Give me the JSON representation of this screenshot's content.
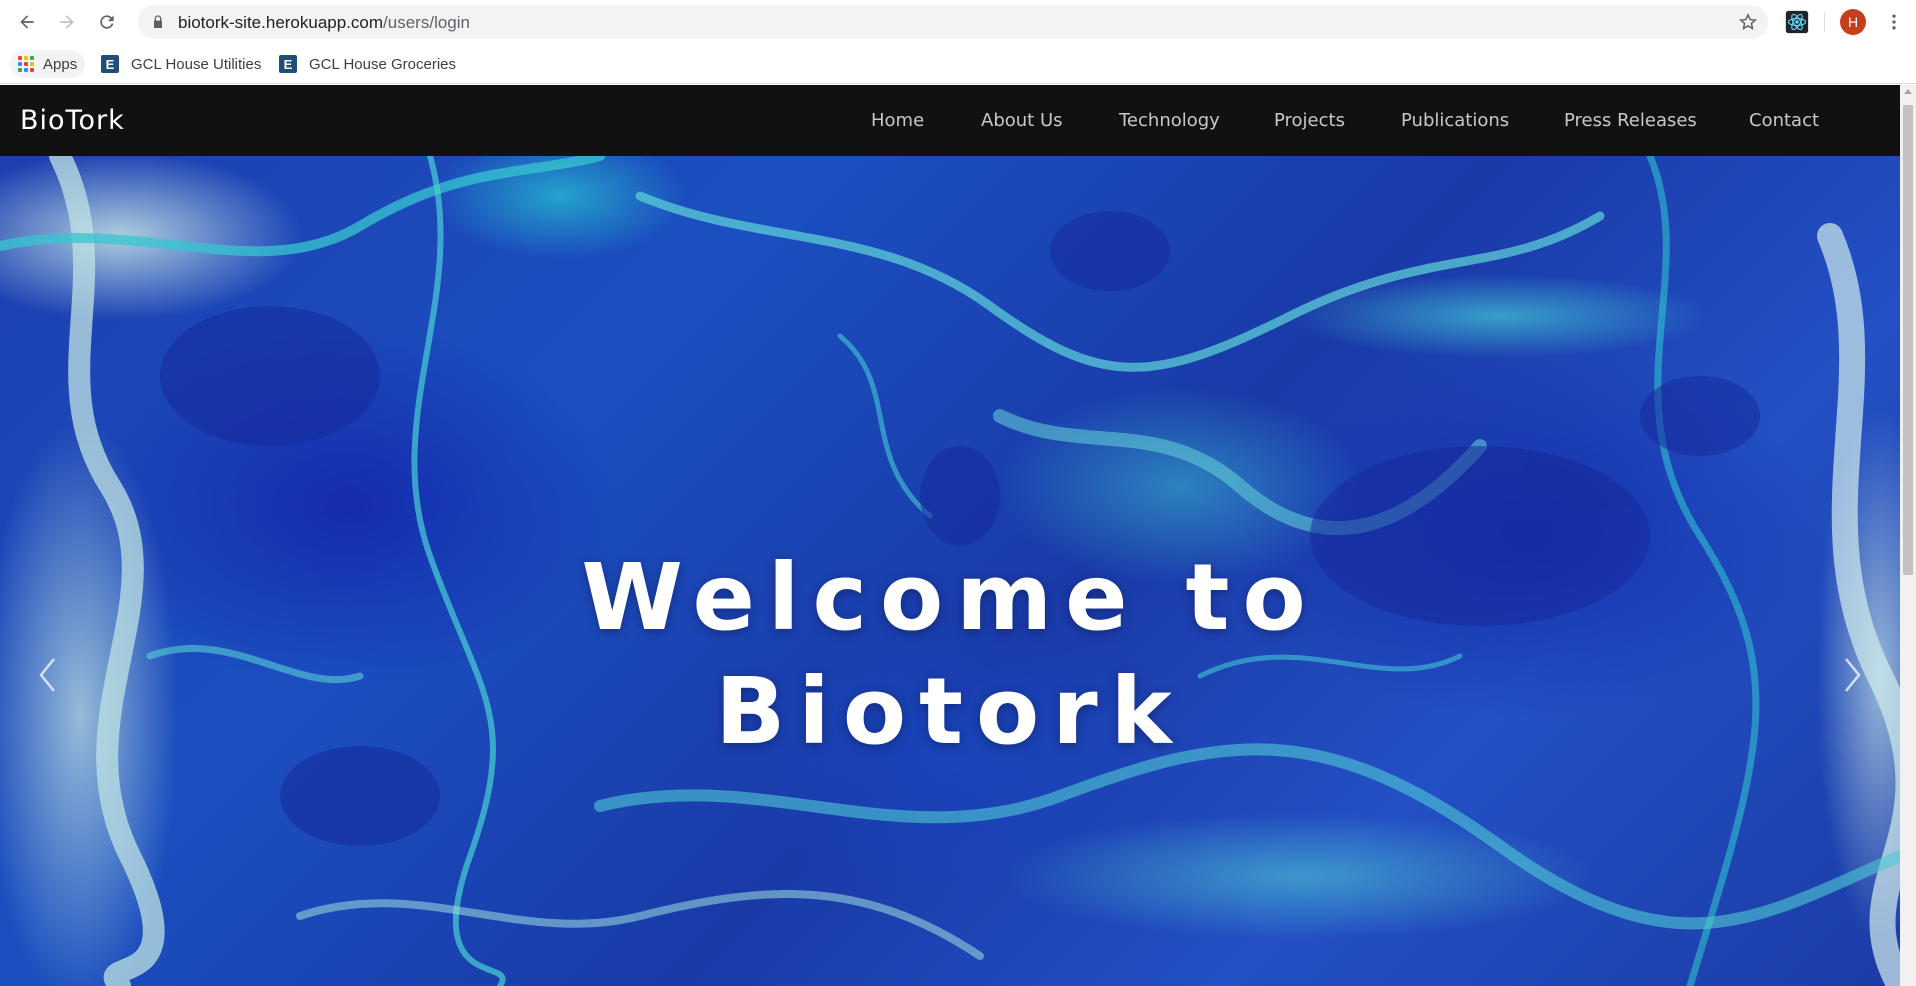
{
  "browser": {
    "url_host": "biotork-site.herokuapp.com",
    "url_path": "/users/login",
    "avatar_letter": "H",
    "bookmarks": {
      "apps_label": "Apps",
      "items": [
        {
          "label": "GCL House Utilities",
          "icon_letter": "E"
        },
        {
          "label": "GCL House Groceries",
          "icon_letter": "E"
        }
      ]
    }
  },
  "site": {
    "brand": "BioTork",
    "nav": [
      {
        "label": "Home"
      },
      {
        "label": "About Us"
      },
      {
        "label": "Technology"
      },
      {
        "label": "Projects"
      },
      {
        "label": "Publications"
      },
      {
        "label": "Press Releases"
      },
      {
        "label": "Contact"
      }
    ],
    "hero": {
      "line1": "Welcome to",
      "line2": "Biotork"
    }
  },
  "colors": {
    "navbar_bg": "#111111",
    "avatar_bg": "#c5401a",
    "hero_deep_blue": "#1d3fb0",
    "hero_turquoise": "#3cc8d2"
  },
  "icons": {
    "back": "arrow-left-icon",
    "forward": "arrow-right-icon",
    "reload": "reload-icon",
    "lock": "lock-icon",
    "bookmark": "star-icon",
    "extension": "react-atom-icon",
    "menu": "three-dots-icon",
    "carousel_prev": "chevron-left-icon",
    "carousel_next": "chevron-right-icon"
  }
}
